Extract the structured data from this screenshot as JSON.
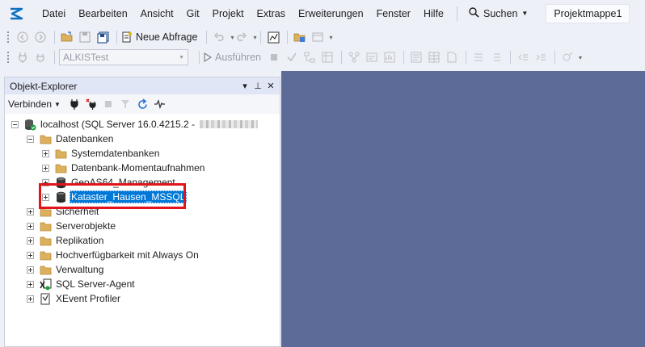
{
  "menu": {
    "items": [
      "Datei",
      "Bearbeiten",
      "Ansicht",
      "Git",
      "Projekt",
      "Extras",
      "Erweiterungen",
      "Fenster",
      "Hilfe"
    ],
    "search_label": "Suchen",
    "project_title": "Projektmappe1"
  },
  "toolbar1": {
    "new_query_label": "Neue Abfrage"
  },
  "toolbar2": {
    "database_value": "ALKISTest",
    "execute_label": "Ausführen"
  },
  "object_explorer": {
    "title": "Objekt-Explorer",
    "connect_label": "Verbinden",
    "title_buttons": [
      "▾",
      "⊥",
      "✕"
    ],
    "server": {
      "label": "localhost (SQL Server 16.0.4215.2 -"
    },
    "databases": {
      "label": "Datenbanken",
      "children": [
        {
          "label": "Systemdatenbanken",
          "icon": "folder-icon"
        },
        {
          "label": "Datenbank-Momentaufnahmen",
          "icon": "folder-icon"
        },
        {
          "label": "GeoAS64_Management",
          "icon": "database-icon"
        },
        {
          "label": "Kataster_Hausen_MSSQL",
          "icon": "database-icon",
          "selected": true
        }
      ]
    },
    "other_nodes": [
      {
        "label": "Sicherheit",
        "icon": "folder-icon"
      },
      {
        "label": "Serverobjekte",
        "icon": "folder-icon"
      },
      {
        "label": "Replikation",
        "icon": "folder-icon"
      },
      {
        "label": "Hochverfügbarkeit mit Always On",
        "icon": "folder-icon"
      },
      {
        "label": "Verwaltung",
        "icon": "folder-icon"
      },
      {
        "label": "SQL Server-Agent",
        "icon": "sql-agent-icon"
      },
      {
        "label": "XEvent Profiler",
        "icon": "xevent-icon"
      }
    ]
  },
  "colors": {
    "accent": "#0078d7",
    "workspace": "#5d6b99",
    "highlight": "#e2141b",
    "folder": "#dcb05c"
  }
}
